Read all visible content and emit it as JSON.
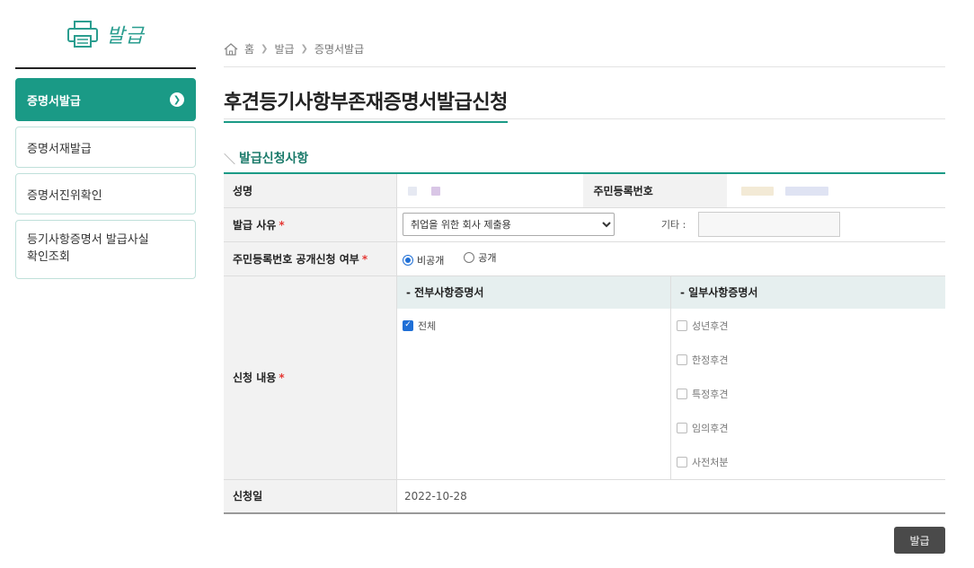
{
  "sidebar": {
    "brand": "발급",
    "items": [
      {
        "label": "증명서발급",
        "active": true
      },
      {
        "label": "증명서재발급"
      },
      {
        "label": "증명서진위확인"
      },
      {
        "label": "등기사항증명서 발급사실\n확인조회"
      }
    ]
  },
  "breadcrumb": [
    "홈",
    "발급",
    "증명서발급"
  ],
  "page_title": "후견등기사항부존재증명서발급신청",
  "section_title": "발급신청사항",
  "form": {
    "name_label": "성명",
    "rrn_label": "주민등록번호",
    "reason_label": "발급 사유",
    "reason_value": "취업을 위한 회사 제출용",
    "other_label": "기타 :",
    "rrn_disclose_label": "주민등록번호 공개신청 여부",
    "radio_private": "비공개",
    "radio_public": "공개",
    "content_label": "신청 내용",
    "full_head": "- 전부사항증명서",
    "partial_head": "- 일부사항증명서",
    "full_items": [
      "전체"
    ],
    "partial_items": [
      "성년후견",
      "한정후견",
      "특정후견",
      "임의후견",
      "사전처분"
    ],
    "date_label": "신청일",
    "date_value": "2022-10-28"
  },
  "buttons": {
    "issue": "발급"
  },
  "colors": {
    "accent": "#1a9a86",
    "required": "#e53935"
  }
}
